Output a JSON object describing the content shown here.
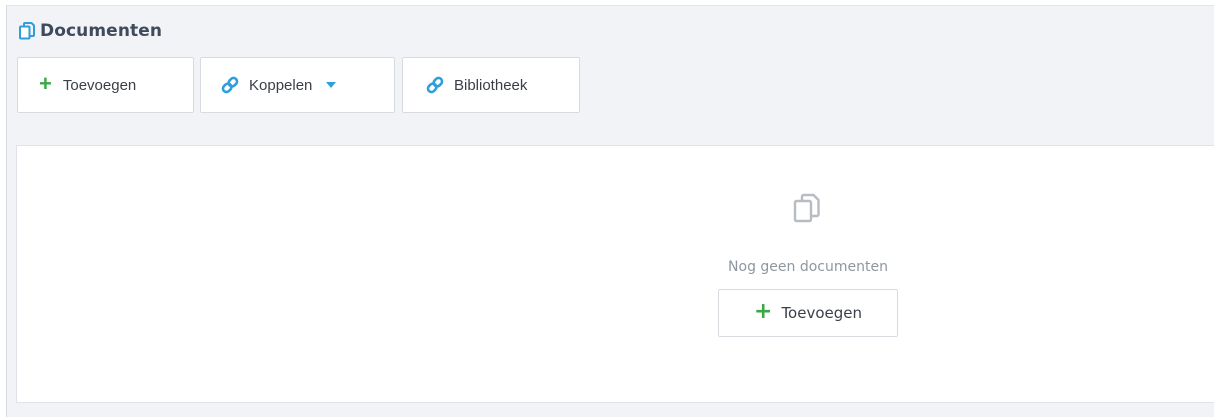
{
  "header": {
    "title": "Documenten",
    "icon": "copy-documents-icon"
  },
  "toolbar": {
    "add_label": "Toevoegen",
    "koppelen_label": "Koppelen",
    "bibliotheek_label": "Bibliotheek",
    "add_icon": "plus-icon",
    "link_icon": "link-icon",
    "dropdown_icon": "caret-down-icon"
  },
  "empty_state": {
    "icon": "copy-documents-icon",
    "message": "Nog geen documenten",
    "add_label": "Toevoegen"
  },
  "colors": {
    "title": "#3f4a5c",
    "accent_blue": "#2e9fdc",
    "plus_green": "#3aa846",
    "muted_text": "#8e979f",
    "panel_bg": "#f1f3f7"
  }
}
